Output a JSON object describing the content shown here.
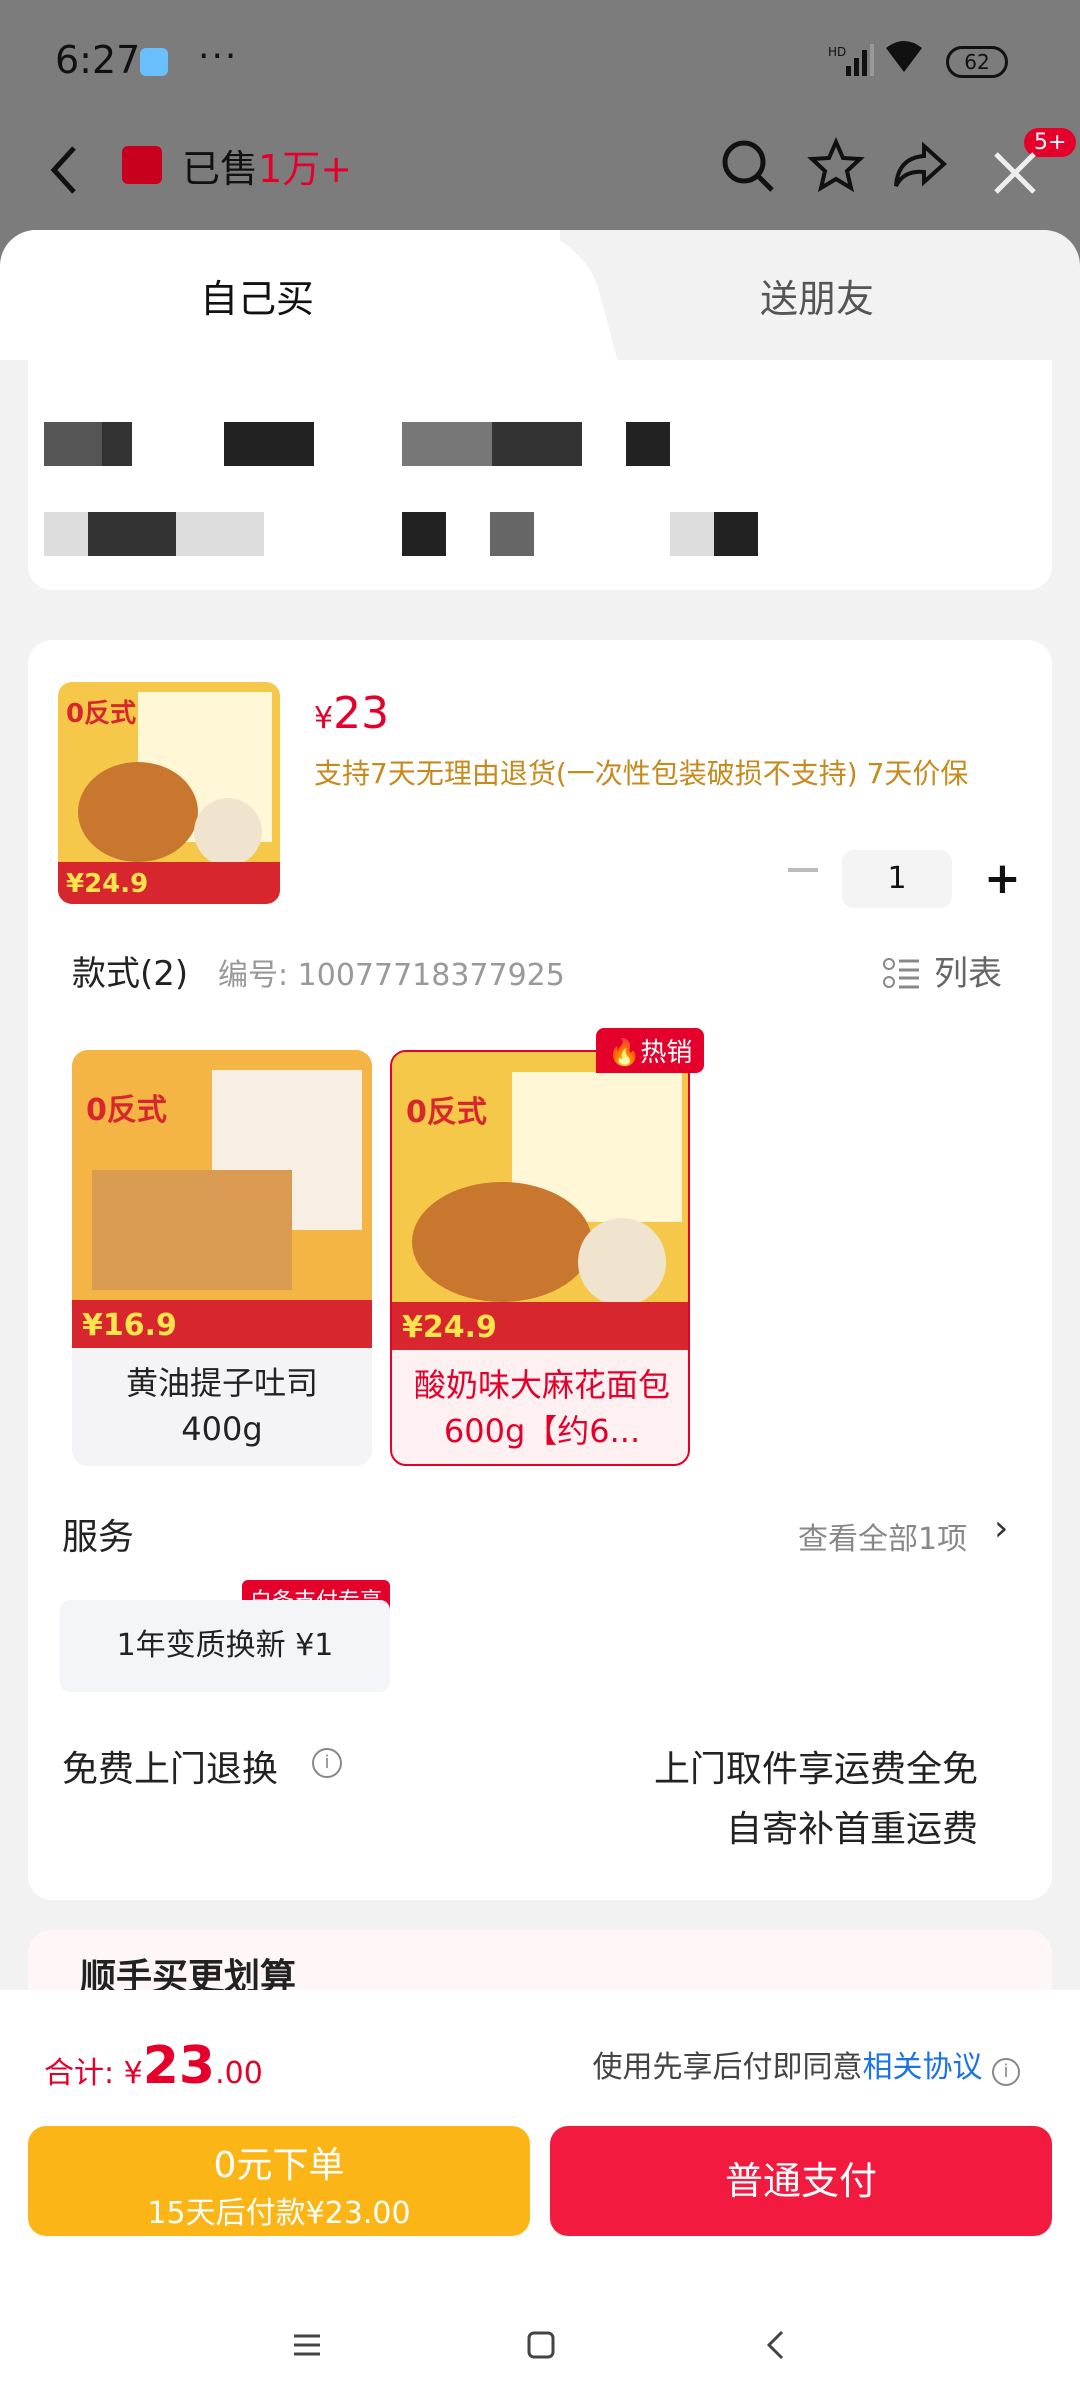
{
  "status_bar": {
    "time": "6:27",
    "more": "···",
    "battery": "62"
  },
  "nav": {
    "sold_prefix": "已售",
    "sold_count": "1万+",
    "notif_badge": "5+"
  },
  "tabs": {
    "self": "自己买",
    "friend": "送朋友"
  },
  "product": {
    "price_symbol": "¥",
    "price": "23",
    "policy": "支持7天无理由退货(一次性包装破损不支持) 7天价保",
    "quantity": "1"
  },
  "styles": {
    "title": "款式(2)",
    "code": "编号: 10077718377925",
    "list_label": "列表",
    "hot_label": "热销",
    "options": [
      {
        "line1": "黄油提子吐司",
        "line2": "400g"
      },
      {
        "line1": "酸奶味大麻花面包",
        "line2": "600g【约6..."
      }
    ]
  },
  "service": {
    "title": "服务",
    "view_all": "查看全部1项",
    "chip_text": "1年变质换新 ¥1",
    "chip_tag": "白条支付专享"
  },
  "free_return": {
    "title": "免费上门退换",
    "line1": "上门取件享运费全免",
    "line2": "自寄补首重运费"
  },
  "more_section": {
    "title": "顺手买更划算"
  },
  "bottom": {
    "total_label": "合计: ",
    "total_symbol": "¥",
    "total_int": "23",
    "total_dec": ".00",
    "agree_text": "使用先享后付即同意",
    "agree_link": "相关协议",
    "zero_btn_line1": "0元下单",
    "zero_btn_line2": "15天后付款¥23.00",
    "pay_btn": "普通支付"
  },
  "colors": {
    "accent": "#e5002b",
    "gold": "#fbb516",
    "pay": "#f21a3f"
  }
}
